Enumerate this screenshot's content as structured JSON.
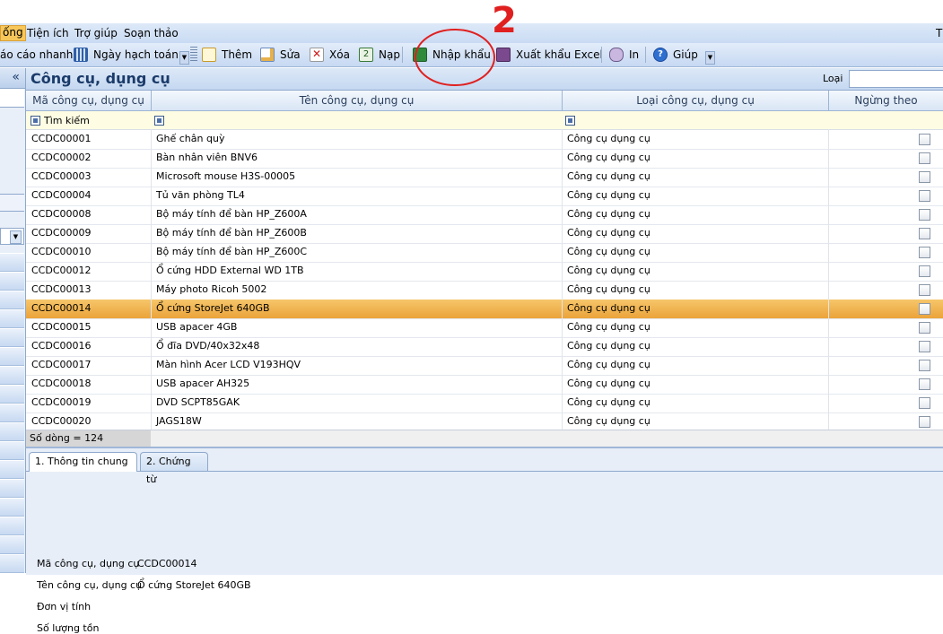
{
  "menu": {
    "items": [
      "ống",
      "Tiện ích",
      "Trợ giúp",
      "Soạn thảo"
    ],
    "right_char": "T"
  },
  "toolbar": {
    "bao_cao_nhanh": "áo cáo nhanh",
    "ngay_hach_toan": "Ngày hạch toán",
    "them": "Thêm",
    "sua": "Sửa",
    "xoa": "Xóa",
    "nap": "Nạp",
    "nhap_khau": "Nhập khẩu",
    "xuat_khau_excel": "Xuất khẩu Excel",
    "in": "In",
    "giup": "Giúp"
  },
  "leftpane": {
    "collapse": "«"
  },
  "panel": {
    "title": "Công cụ, dụng cụ",
    "loai_label": "Loại",
    "loai_value": ""
  },
  "columns": [
    "Mã công cụ, dụng cụ",
    "Tên công cụ, dụng cụ",
    "Loại công cụ, dụng cụ",
    "Ngừng theo"
  ],
  "filter": {
    "search_label": "Tìm kiếm"
  },
  "rows": [
    {
      "code": "CCDC00001",
      "name": "Ghế chân quỳ",
      "type": "Công cụ dụng cụ",
      "stopped": false
    },
    {
      "code": "CCDC00002",
      "name": "Bàn nhân viên BNV6",
      "type": "Công cụ dụng cụ",
      "stopped": false
    },
    {
      "code": "CCDC00003",
      "name": "Microsoft mouse H3S-00005",
      "type": "Công cụ dụng cụ",
      "stopped": false
    },
    {
      "code": "CCDC00004",
      "name": "Tủ văn phòng TL4",
      "type": "Công cụ dụng cụ",
      "stopped": false
    },
    {
      "code": "CCDC00008",
      "name": "Bộ máy tính để bàn HP_Z600A",
      "type": "Công cụ dụng cụ",
      "stopped": false
    },
    {
      "code": "CCDC00009",
      "name": "Bộ máy tính để bàn HP_Z600B",
      "type": "Công cụ dụng cụ",
      "stopped": false
    },
    {
      "code": "CCDC00010",
      "name": "Bộ máy tính để bàn HP_Z600C",
      "type": "Công cụ dụng cụ",
      "stopped": false
    },
    {
      "code": "CCDC00012",
      "name": "Ổ cứng HDD External WD 1TB",
      "type": "Công cụ dụng cụ",
      "stopped": false
    },
    {
      "code": "CCDC00013",
      "name": "Máy photo Ricoh 5002",
      "type": "Công cụ dụng cụ",
      "stopped": false
    },
    {
      "code": "CCDC00014",
      "name": "Ổ cứng StoreJet 640GB",
      "type": "Công cụ dụng cụ",
      "stopped": false,
      "selected": true
    },
    {
      "code": "CCDC00015",
      "name": "USB apacer 4GB",
      "type": "Công cụ dụng cụ",
      "stopped": false
    },
    {
      "code": "CCDC00016",
      "name": "Ổ đĩa DVD/40x32x48",
      "type": "Công cụ dụng cụ",
      "stopped": false
    },
    {
      "code": "CCDC00017",
      "name": "Màn hình Acer LCD V193HQV",
      "type": "Công cụ dụng cụ",
      "stopped": false
    },
    {
      "code": "CCDC00018",
      "name": "USB apacer AH325",
      "type": "Công cụ dụng cụ",
      "stopped": false
    },
    {
      "code": "CCDC00019",
      "name": "DVD SCPT85GAK",
      "type": "Công cụ dụng cụ",
      "stopped": false
    },
    {
      "code": "CCDC00020",
      "name": "JAGS18W",
      "type": "Công cụ dụng cụ",
      "stopped": false
    }
  ],
  "footer": {
    "row_count": "Số dòng = 124"
  },
  "detail": {
    "tabs": [
      "1. Thông tin chung",
      "2. Chứng từ"
    ],
    "fields": [
      {
        "label": "Mã công cụ, dụng cụ",
        "value": "CCDC00014"
      },
      {
        "label": "Tên công cụ, dụng cụ",
        "value": "Ổ cứng StoreJet 640GB"
      },
      {
        "label": "Đơn vị tính",
        "value": ""
      },
      {
        "label": "Số lượng tồn",
        "value": ""
      }
    ]
  },
  "annotation": {
    "text": "2",
    "color": "#e02020"
  },
  "colors": {
    "selected_row": "#f0b048",
    "header_text": "#1b3b6a",
    "filter_row": "#fefde3"
  }
}
